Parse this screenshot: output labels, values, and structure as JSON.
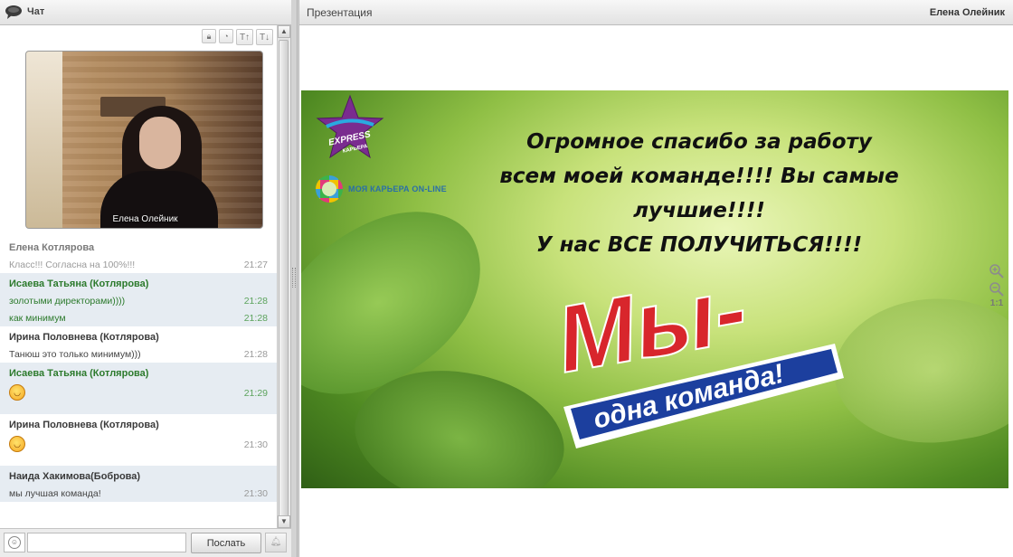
{
  "chat": {
    "title": "Чат",
    "video_caption": "Елена Олейник",
    "tools": [
      "lock",
      "clock",
      "T↑",
      "T↓"
    ],
    "messages": [
      {
        "author": "Елена Котлярова",
        "author_style": "grey",
        "alt": false,
        "lines": [
          {
            "text": "Класс!!! Согласна на 100%!!!",
            "time": "21:27",
            "style": "grey"
          }
        ]
      },
      {
        "author": "Исаева Татьяна (Котлярова)",
        "author_style": "green",
        "alt": true,
        "lines": [
          {
            "text": "золотыми директорами))))",
            "time": "21:28",
            "style": "green"
          },
          {
            "text": "как минимум",
            "time": "21:28",
            "style": "green"
          }
        ]
      },
      {
        "author": "Ирина Половнева (Котлярова)",
        "author_style": "dark",
        "alt": false,
        "lines": [
          {
            "text": "Танюш это только минимум)))",
            "time": "21:28",
            "style": "dark"
          }
        ]
      },
      {
        "author": "Исаева Татьяна (Котлярова)",
        "author_style": "green",
        "alt": true,
        "lines": [
          {
            "text": "",
            "emoji": "laugh",
            "time": "21:29",
            "style": "green"
          }
        ]
      },
      {
        "author": "Ирина Половнева (Котлярова)",
        "author_style": "dark",
        "alt": false,
        "lines": [
          {
            "text": "",
            "emoji": "laugh",
            "time": "21:30",
            "style": "dark"
          }
        ]
      },
      {
        "author": "Наида Хакимова(Боброва)",
        "author_style": "dark",
        "alt": true,
        "lines": [
          {
            "text": "мы лучшая команда!",
            "time": "21:30",
            "style": "dark"
          }
        ]
      }
    ],
    "input": {
      "value": "",
      "placeholder": ""
    },
    "send_label": "Послать"
  },
  "presentation": {
    "title": "Презентация",
    "presenter": "Елена Олейник",
    "slide": {
      "express_logo_text": [
        "EXPRESS",
        "КАРЬЕРА"
      ],
      "career_logo_name": "МОЯ КАРЬЕРА ON-LINE",
      "career_logo_tagline": "",
      "message_lines": [
        "Огромное спасибо за работу",
        "всем моей команде!!!! Вы самые",
        "лучшие!!!!",
        "У нас ВСЕ ПОЛУЧИТЬСЯ!!!!"
      ],
      "team_logo_big": "Мы-",
      "team_logo_small": "одна команда!"
    },
    "zoom_reset_label": "1:1"
  },
  "colors": {
    "green_author": "#2c7a2c",
    "alt_row": "#e6ecf2",
    "logo_red": "#d8262c",
    "logo_blue": "#1c3f9e"
  }
}
